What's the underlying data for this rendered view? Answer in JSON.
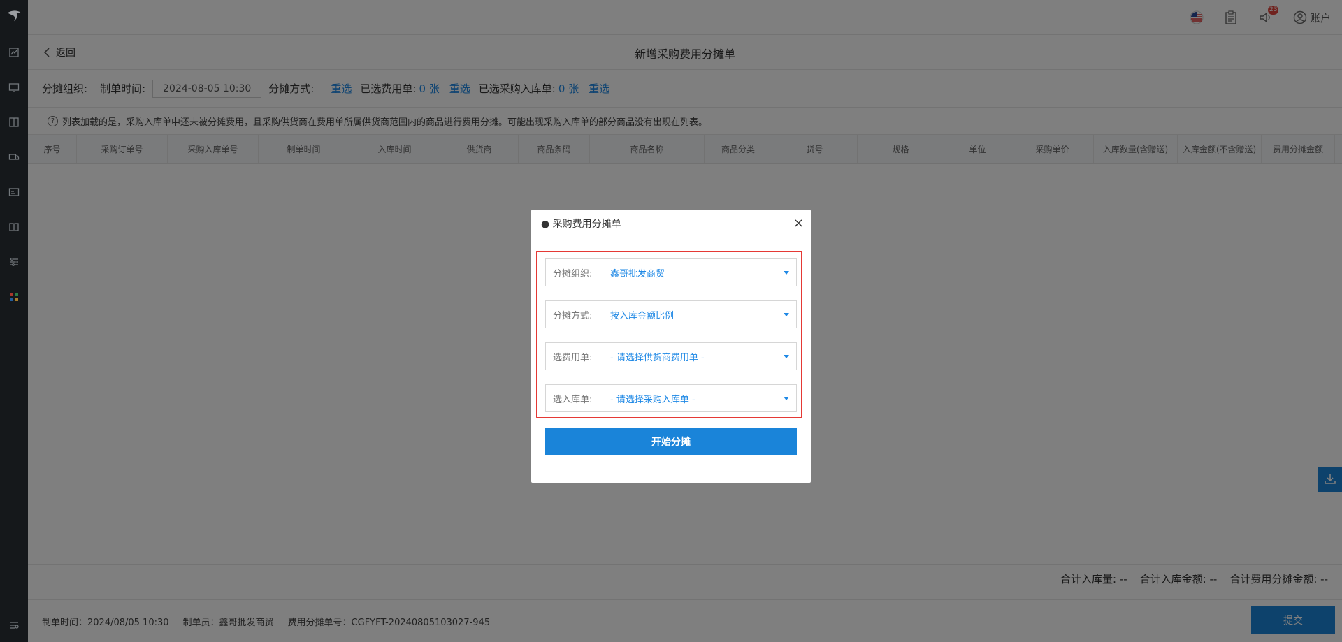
{
  "topbar": {
    "account_label": "账户",
    "notifications_badge": "23"
  },
  "header": {
    "back_label": "返回",
    "title": "新增采购费用分摊单"
  },
  "filters": {
    "org_label": "分摊组织:",
    "time_label": "制单时间:",
    "time_value": "2024-08-05 10:30",
    "method_label": "分摊方式:",
    "reselect1": "重选",
    "fee_label": "已选费用单:",
    "fee_count": "0 张",
    "reselect2": "重选",
    "stock_label": "已选采购入库单:",
    "stock_count": "0 张",
    "reselect3": "重选"
  },
  "tip": "列表加载的是，采购入库单中还未被分摊费用，且采购供货商在费用单所属供货商范围内的商品进行费用分摊。可能出现采购入库单的部分商品没有出现在列表。",
  "table": {
    "columns": [
      "序号",
      "采购订单号",
      "采购入库单号",
      "制单时间",
      "入库时间",
      "供货商",
      "商品条码",
      "商品名称",
      "商品分类",
      "货号",
      "规格",
      "单位",
      "采购单价",
      "入库数量(含赠送)",
      "入库金额(不含赠送)",
      "费用分摊金额"
    ]
  },
  "summary": {
    "qty_label": "合计入库量:",
    "qty_value": "--",
    "amount_label": "合计入库金额:",
    "amount_value": "--",
    "fee_label": "合计费用分摊金额:",
    "fee_value": "--"
  },
  "bottombar": {
    "time": "制单时间：2024/08/05 10:30",
    "creator": "制单员：鑫哥批发商贸",
    "number": "费用分摊单号：CGFYFT-20240805103027-945",
    "submit_label": "提交"
  },
  "modal": {
    "title": "● 采购费用分摊单",
    "close": "×",
    "fields": [
      {
        "label": "分摊组织:",
        "value": "鑫哥批发商贸"
      },
      {
        "label": "分摊方式:",
        "value": "按入库金额比例"
      },
      {
        "label": "选费用单:",
        "value": "- 请选择供货商费用单 -"
      },
      {
        "label": "选入库单:",
        "value": "- 请选择采购入库单 -"
      }
    ],
    "start_label": "开始分摊"
  },
  "colors": {
    "accent": "#1a84d9",
    "link": "#1e88e5",
    "highlight": "#e53935",
    "sidebar": "#1c2025"
  }
}
